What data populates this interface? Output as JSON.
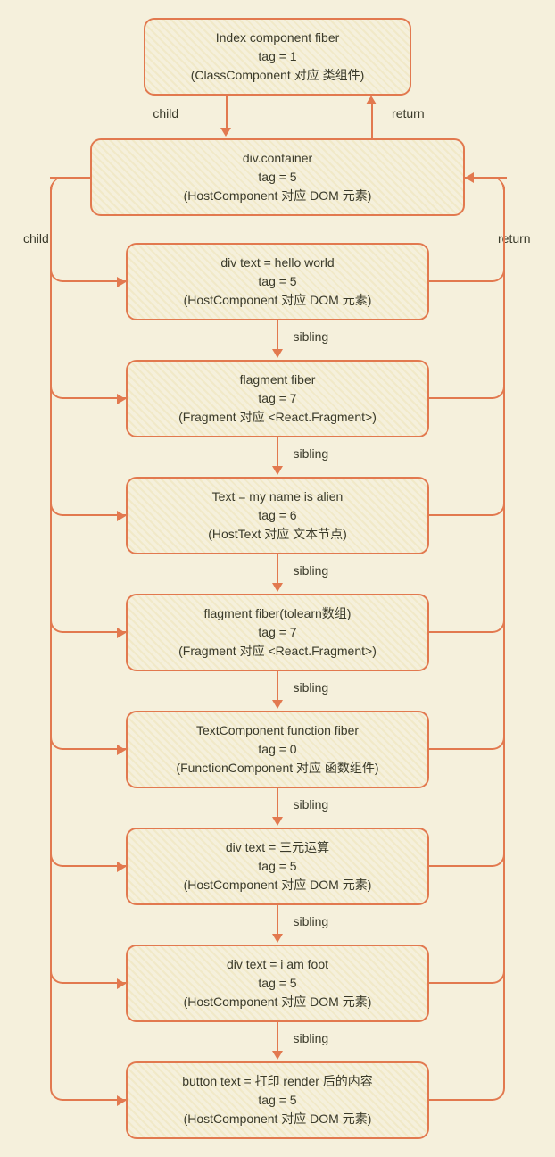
{
  "labels": {
    "child": "child",
    "return": "return",
    "sibling": "sibling"
  },
  "nodes": {
    "root": {
      "l1": "Index component fiber",
      "l2": "tag = 1",
      "l3": "(ClassComponent 对应 类组件)"
    },
    "container": {
      "l1": "div.container",
      "l2": "tag = 5",
      "l3": "(HostComponent 对应 DOM 元素)"
    },
    "c0": {
      "l1": "div text = hello world",
      "l2": "tag = 5",
      "l3": "(HostComponent 对应 DOM 元素)"
    },
    "c1": {
      "l1": "flagment fiber",
      "l2": "tag = 7",
      "l3": "(Fragment 对应 <React.Fragment>)"
    },
    "c2": {
      "l1": "Text = my name is alien",
      "l2": "tag = 6",
      "l3": "(HostText 对应 文本节点)"
    },
    "c3": {
      "l1": "flagment fiber(tolearn数组)",
      "l2": "tag = 7",
      "l3": "(Fragment 对应 <React.Fragment>)"
    },
    "c4": {
      "l1": "TextComponent function fiber",
      "l2": "tag = 0",
      "l3": "(FunctionComponent 对应 函数组件)"
    },
    "c5": {
      "l1": "div text = 三元运算",
      "l2": "tag = 5",
      "l3": "(HostComponent 对应 DOM 元素)"
    },
    "c6": {
      "l1": "div text = i am foot",
      "l2": "tag = 5",
      "l3": "(HostComponent 对应 DOM 元素)"
    },
    "c7": {
      "l1": "button text = 打印 render 后的内容",
      "l2": "tag = 5",
      "l3": "(HostComponent 对应 DOM 元素)"
    }
  }
}
